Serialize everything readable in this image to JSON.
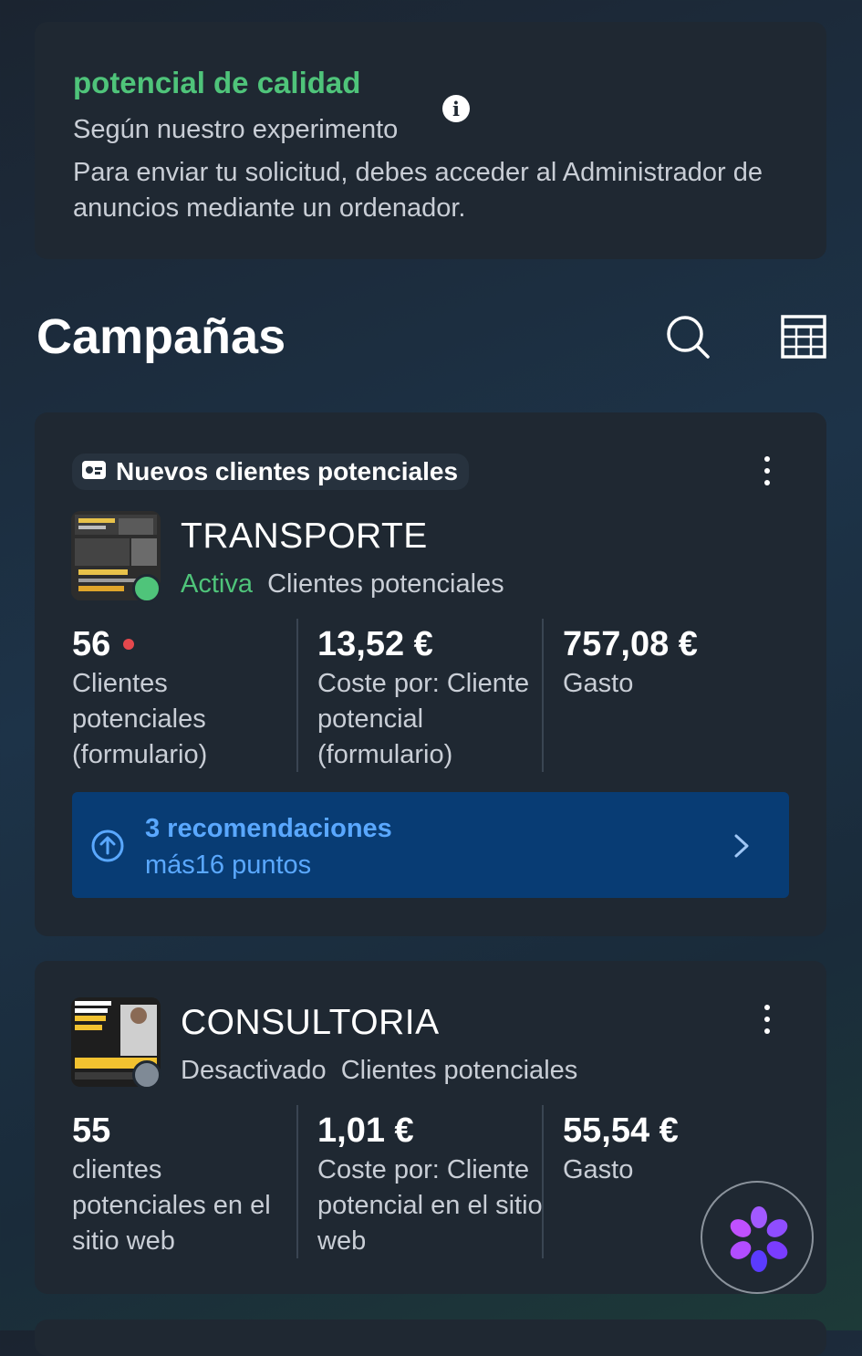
{
  "quality_card": {
    "title": "potencial de calidad",
    "subtitle": "Según nuestro experimento",
    "body": "Para enviar tu solicitud, debes acceder al Administrador de anuncios mediante un ordenador.",
    "info_icon": "i"
  },
  "section": {
    "title": "Campañas",
    "search_icon": "search-icon",
    "table_icon": "table-icon"
  },
  "campaigns": [
    {
      "objective_label": "Nuevos clientes potenciales",
      "name": "TRANSPORTE",
      "status": "Activa",
      "result_type": "Clientes potenciales",
      "status_color": "#4fc47a",
      "metrics": [
        {
          "value": "56",
          "label": "Clientes potenciales (formulario)"
        },
        {
          "value": "13,52 €",
          "label": "Coste por: Cliente potencial (formulario)"
        },
        {
          "value": "757,08 €",
          "label": "Gasto"
        }
      ],
      "recommendations": {
        "title": "3 recomendaciones",
        "subtitle": "más16 puntos"
      }
    },
    {
      "name": "CONSULTORIA",
      "status": "Desactivado",
      "result_type": "Clientes potenciales",
      "status_color": "#7f8a96",
      "metrics": [
        {
          "value": "55",
          "label": "clientes potenciales en el sitio web"
        },
        {
          "value": "1,01 €",
          "label": "Coste por: Cliente potencial en el sitio web"
        },
        {
          "value": "55,54 €",
          "label": "Gasto"
        }
      ]
    }
  ],
  "colors": {
    "accent_green": "#4fc47a",
    "recommendation_bg": "#083c74",
    "recommendation_text": "#5aa8ff",
    "alert_dot": "#e5484d"
  }
}
